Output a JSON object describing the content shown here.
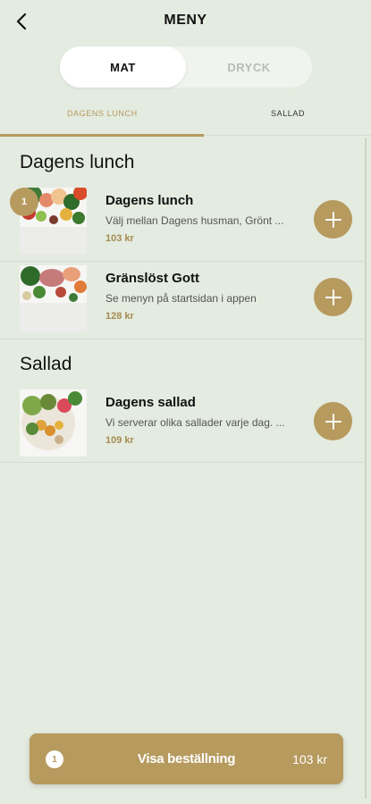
{
  "header": {
    "title": "MENY",
    "back_icon": "chevron-left-icon"
  },
  "segment": {
    "options": [
      "MAT",
      "DRYCK"
    ],
    "selected": "MAT"
  },
  "category_tabs": [
    {
      "label": "DAGENS LUNCH",
      "active": true
    },
    {
      "label": "SALLAD",
      "active": false
    }
  ],
  "sections": [
    {
      "title": "Dagens lunch",
      "items": [
        {
          "name": "Dagens lunch",
          "description": "Välj mellan Dagens husman, Grönt ...",
          "price": "103 kr",
          "quantity": "1"
        },
        {
          "name": "Gränslöst Gott",
          "description": "Se menyn på startsidan i appen",
          "price": "128 kr"
        }
      ]
    },
    {
      "title": "Sallad",
      "items": [
        {
          "name": "Dagens sallad",
          "description": "Vi serverar olika sallader varje dag. ...",
          "price": "109 kr"
        }
      ]
    }
  ],
  "order_bar": {
    "count": "1",
    "label": "Visa beställning",
    "total": "103 kr"
  },
  "colors": {
    "accent": "#b69a5e",
    "background": "#e4ebe0",
    "white": "#ffffff"
  }
}
